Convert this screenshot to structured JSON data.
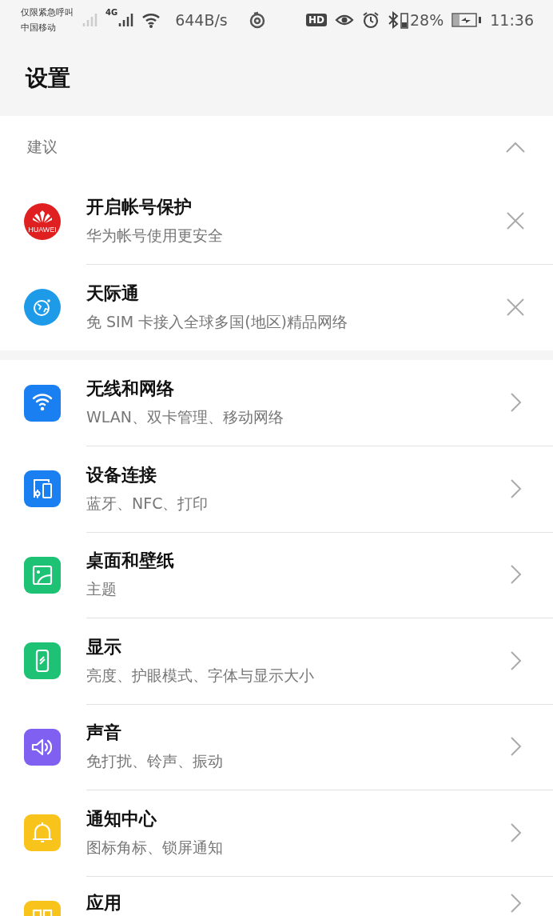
{
  "status_bar": {
    "carrier_top": "仅限紧急呼叫",
    "carrier_bottom": "中国移动",
    "network": "4G",
    "speed": "644B/s",
    "hd": "HD",
    "battery_percent": "28%",
    "time": "11:36"
  },
  "header": {
    "title": "设置"
  },
  "suggestions": {
    "title": "建议",
    "expanded": true,
    "items": [
      {
        "title": "开启帐号保护",
        "subtitle": "华为帐号使用更安全",
        "color": "#e02020",
        "logo_text": "HUAWEI"
      },
      {
        "title": "天际通",
        "subtitle": "免 SIM 卡接入全球多国(地区)精品网络",
        "color": "#1e9be8"
      }
    ]
  },
  "settings": [
    {
      "title": "无线和网络",
      "subtitle": "WLAN、双卡管理、移动网络",
      "color": "#1a7ff0"
    },
    {
      "title": "设备连接",
      "subtitle": "蓝牙、NFC、打印",
      "color": "#1a7ff0"
    },
    {
      "title": "桌面和壁纸",
      "subtitle": "主题",
      "color": "#1dc274"
    },
    {
      "title": "显示",
      "subtitle": "亮度、护眼模式、字体与显示大小",
      "color": "#1dc274"
    },
    {
      "title": "声音",
      "subtitle": "免打扰、铃声、振动",
      "color": "#8060f0"
    },
    {
      "title": "通知中心",
      "subtitle": "图标角标、锁屏通知",
      "color": "#f8c41c"
    },
    {
      "title": "应用",
      "color": "#f8c41c"
    }
  ]
}
